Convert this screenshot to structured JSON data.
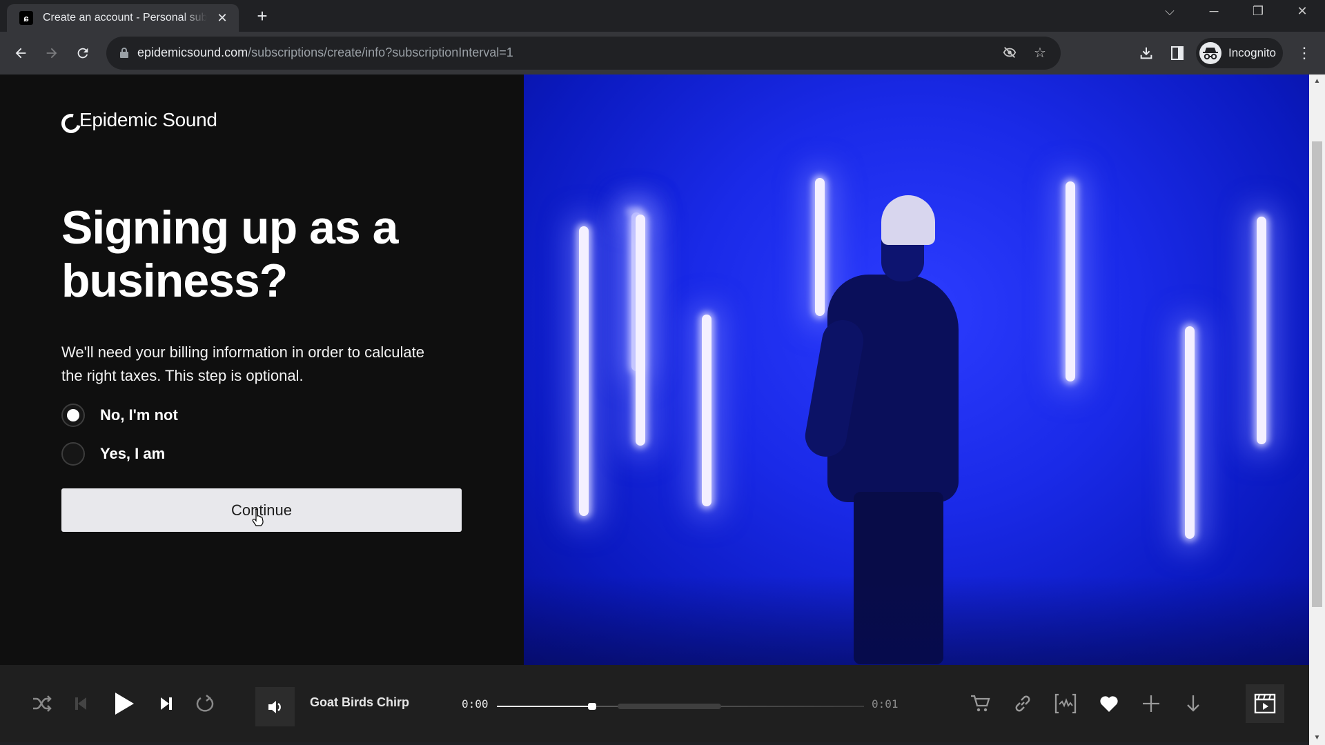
{
  "browser": {
    "tab": {
      "title": "Create an account - Personal subscription",
      "favicon": "epidemic-sound-logo"
    },
    "url_host": "epidemicsound.com",
    "url_path": "/subscriptions/create/info?subscriptionInterval=1",
    "profile_label": "Incognito",
    "icons": {
      "back": "arrow-left-icon",
      "forward": "arrow-right-icon",
      "reload": "reload-icon",
      "tracking": "eye-off-icon",
      "bookmark": "star-icon",
      "downloads": "download-icon",
      "side_panel": "side-panel-icon",
      "menu": "more-vertical-icon"
    },
    "window_controls": {
      "tab_search": "⌵",
      "minimize": "─",
      "restore": "❐",
      "close": "✕"
    }
  },
  "page": {
    "brand": "Epidemic Sound",
    "heading": "Signing up as a business?",
    "description": "We'll need your billing information in order to calculate the right taxes. This step is optional.",
    "options": [
      {
        "label": "No, I'm not",
        "checked": true
      },
      {
        "label": "Yes, I am",
        "checked": false
      }
    ],
    "continue_label": "Continue"
  },
  "player": {
    "track_title": "Goat Birds Chirp",
    "current_time": "0:00",
    "duration": "0:01",
    "progress_percent": 26,
    "controls": [
      "shuffle-icon",
      "previous-icon",
      "play-icon",
      "next-icon",
      "repeat-icon",
      "volume-icon"
    ],
    "actions": [
      "cart-icon",
      "link-icon",
      "stems-icon",
      "heart-icon",
      "plus-icon",
      "download-icon",
      "video-icon"
    ],
    "liked": true
  }
}
